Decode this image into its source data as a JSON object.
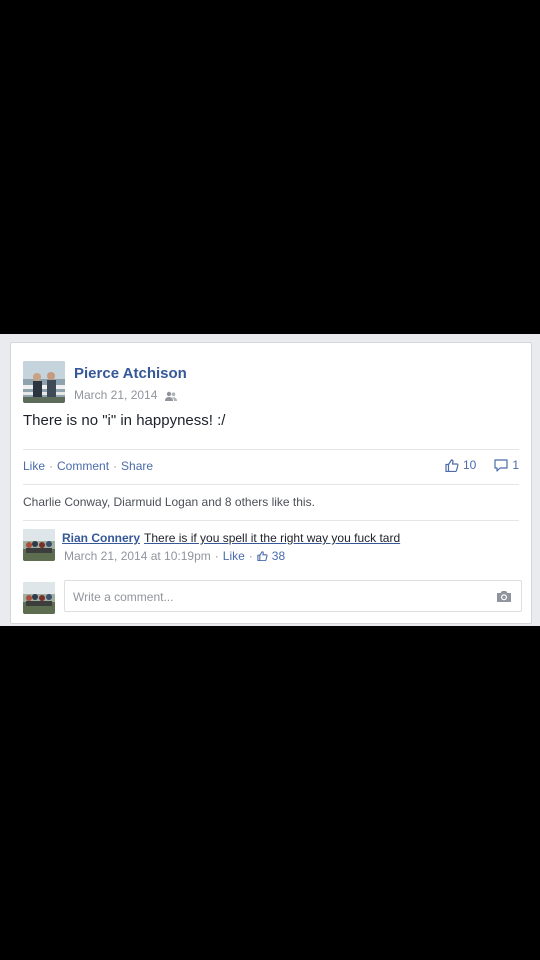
{
  "post": {
    "author": "Pierce Atchison",
    "date": "March 21, 2014",
    "text": "There is no \"i\" in happyness! :/",
    "actions": {
      "like": "Like",
      "comment": "Comment",
      "share": "Share",
      "sep": "·"
    },
    "counts": {
      "likes": "10",
      "comments": "1"
    },
    "likes_summary": "Charlie Conway, Diarmuid Logan and 8 others like this."
  },
  "comment": {
    "author": "Rian Connery",
    "text": "There is if you spell it the right way you fuck tard",
    "time": "March 21, 2014 at 10:19pm",
    "sep": "·",
    "like_label": "Like",
    "likes": "38"
  },
  "composer": {
    "placeholder": "Write a comment..."
  },
  "icons": {
    "audience": "friends-icon",
    "like": "thumbs-up-icon",
    "comment": "speech-bubble-icon",
    "camera": "camera-icon"
  },
  "colors": {
    "link": "#365899",
    "action": "#4b6bab",
    "meta": "#90949c",
    "background": "#000000"
  }
}
